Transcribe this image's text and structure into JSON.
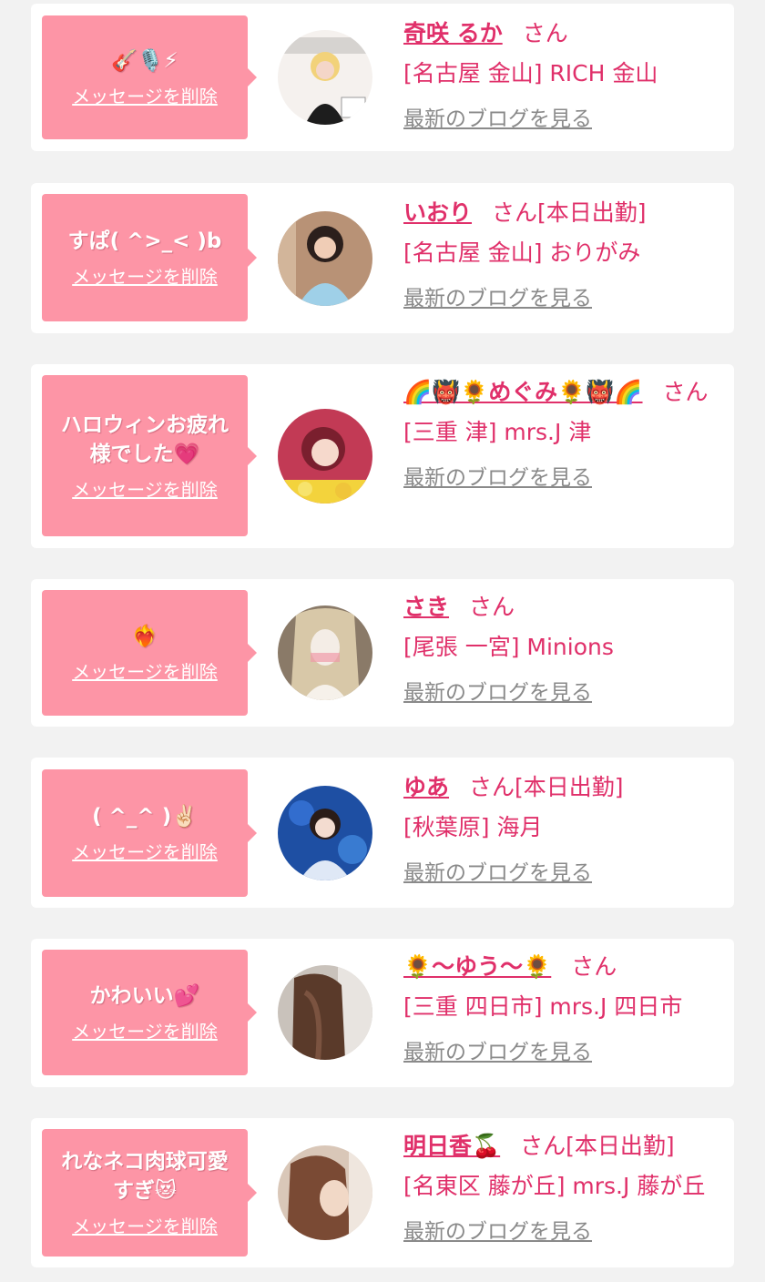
{
  "messages": [
    {
      "text": "🎸🎙️⚡",
      "delete_label": "メッセージを削除",
      "name": "奇咲 るか",
      "honorific": "さん",
      "status": "",
      "shop": "[名古屋 金山] RICH 金山",
      "blog_link": "最新のブログを見る"
    },
    {
      "text": "すぱ( ^>_< )b",
      "delete_label": "メッセージを削除",
      "name": "いおり",
      "honorific": "さん",
      "status": "[本日出勤]",
      "shop": "[名古屋 金山] おりがみ",
      "blog_link": "最新のブログを見る"
    },
    {
      "text": "ハロウィンお疲れ\n様でした💗",
      "delete_label": "メッセージを削除",
      "name": "🌈👹🌻めぐみ🌻👹🌈",
      "honorific": "さん",
      "status": "",
      "shop": "[三重 津] mrs.J 津",
      "blog_link": "最新のブログを見る"
    },
    {
      "text": "❤️‍🔥",
      "delete_label": "メッセージを削除",
      "name": "さき",
      "honorific": "さん",
      "status": "",
      "shop": "[尾張 一宮] Minions",
      "blog_link": "最新のブログを見る"
    },
    {
      "text": "( ^_^ )✌🏻",
      "delete_label": "メッセージを削除",
      "name": "ゆあ",
      "honorific": "さん",
      "status": "[本日出勤]",
      "shop": "[秋葉原] 海月",
      "blog_link": "最新のブログを見る"
    },
    {
      "text": "かわいい💕",
      "delete_label": "メッセージを削除",
      "name": "🌻〜ゆう〜🌻",
      "honorific": "さん",
      "status": "",
      "shop": "[三重 四日市] mrs.J 四日市",
      "blog_link": "最新のブログを見る"
    },
    {
      "text": "れなネコ肉球可愛\nすぎ😻",
      "delete_label": "メッセージを削除",
      "name": "明日香🍒",
      "honorific": "さん",
      "status": "[本日出勤]",
      "shop": "[名東区 藤が丘] mrs.J 藤が丘",
      "blog_link": "最新のブログを見る"
    }
  ],
  "colors": {
    "bubble": "#fd95a6",
    "accent": "#e0306a",
    "link_gray": "#8a8a8a",
    "background": "#f2f2f2"
  }
}
